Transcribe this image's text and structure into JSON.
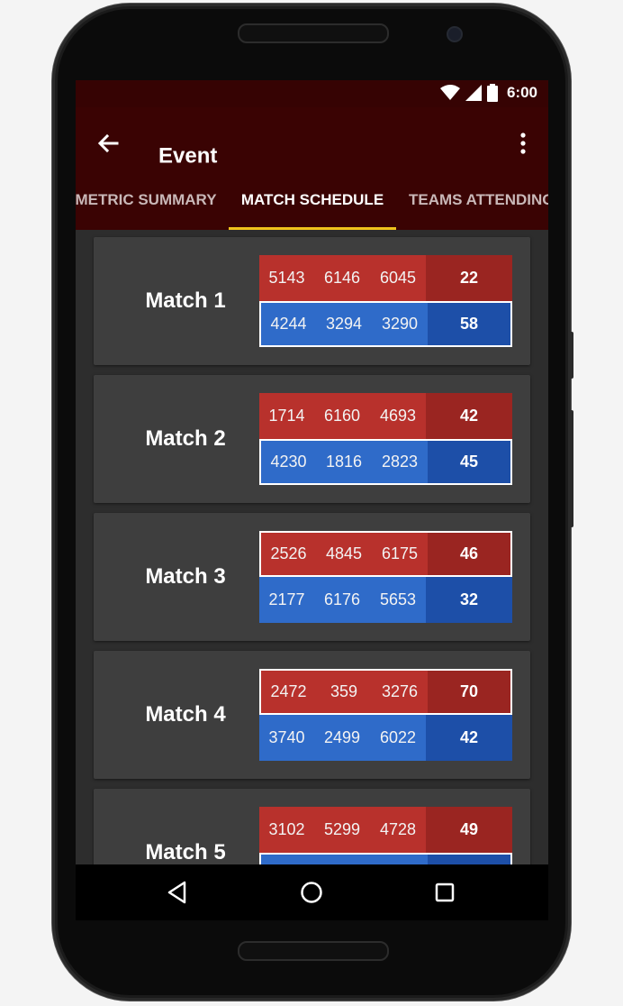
{
  "status": {
    "time": "6:00"
  },
  "appbar": {
    "title": "Event"
  },
  "tabs": [
    {
      "label": "METRIC SUMMARY",
      "active": false
    },
    {
      "label": "MATCH SCHEDULE",
      "active": true
    },
    {
      "label": "TEAMS ATTENDING",
      "active": false
    }
  ],
  "colors": {
    "red": "#b8312c",
    "blue": "#2f6bc9",
    "indicator": "#f0c31c",
    "appbar": "#3a0303"
  },
  "matches": [
    {
      "label": "Match 1",
      "red": {
        "teams": [
          "5143",
          "6146",
          "6045"
        ],
        "score": "22"
      },
      "blue": {
        "teams": [
          "4244",
          "3294",
          "3290"
        ],
        "score": "58"
      },
      "winner": "blue"
    },
    {
      "label": "Match 2",
      "red": {
        "teams": [
          "1714",
          "6160",
          "4693"
        ],
        "score": "42"
      },
      "blue": {
        "teams": [
          "4230",
          "1816",
          "2823"
        ],
        "score": "45"
      },
      "winner": "blue"
    },
    {
      "label": "Match 3",
      "red": {
        "teams": [
          "2526",
          "4845",
          "6175"
        ],
        "score": "46"
      },
      "blue": {
        "teams": [
          "2177",
          "6176",
          "5653"
        ],
        "score": "32"
      },
      "winner": "red"
    },
    {
      "label": "Match 4",
      "red": {
        "teams": [
          "2472",
          "359",
          "3276"
        ],
        "score": "70"
      },
      "blue": {
        "teams": [
          "3740",
          "2499",
          "6022"
        ],
        "score": "42"
      },
      "winner": "red"
    },
    {
      "label": "Match 5",
      "red": {
        "teams": [
          "3102",
          "5299",
          "4728"
        ],
        "score": "49"
      },
      "blue": {
        "teams": [
          "",
          "",
          ""
        ],
        "score": ""
      },
      "winner": "blue"
    }
  ]
}
